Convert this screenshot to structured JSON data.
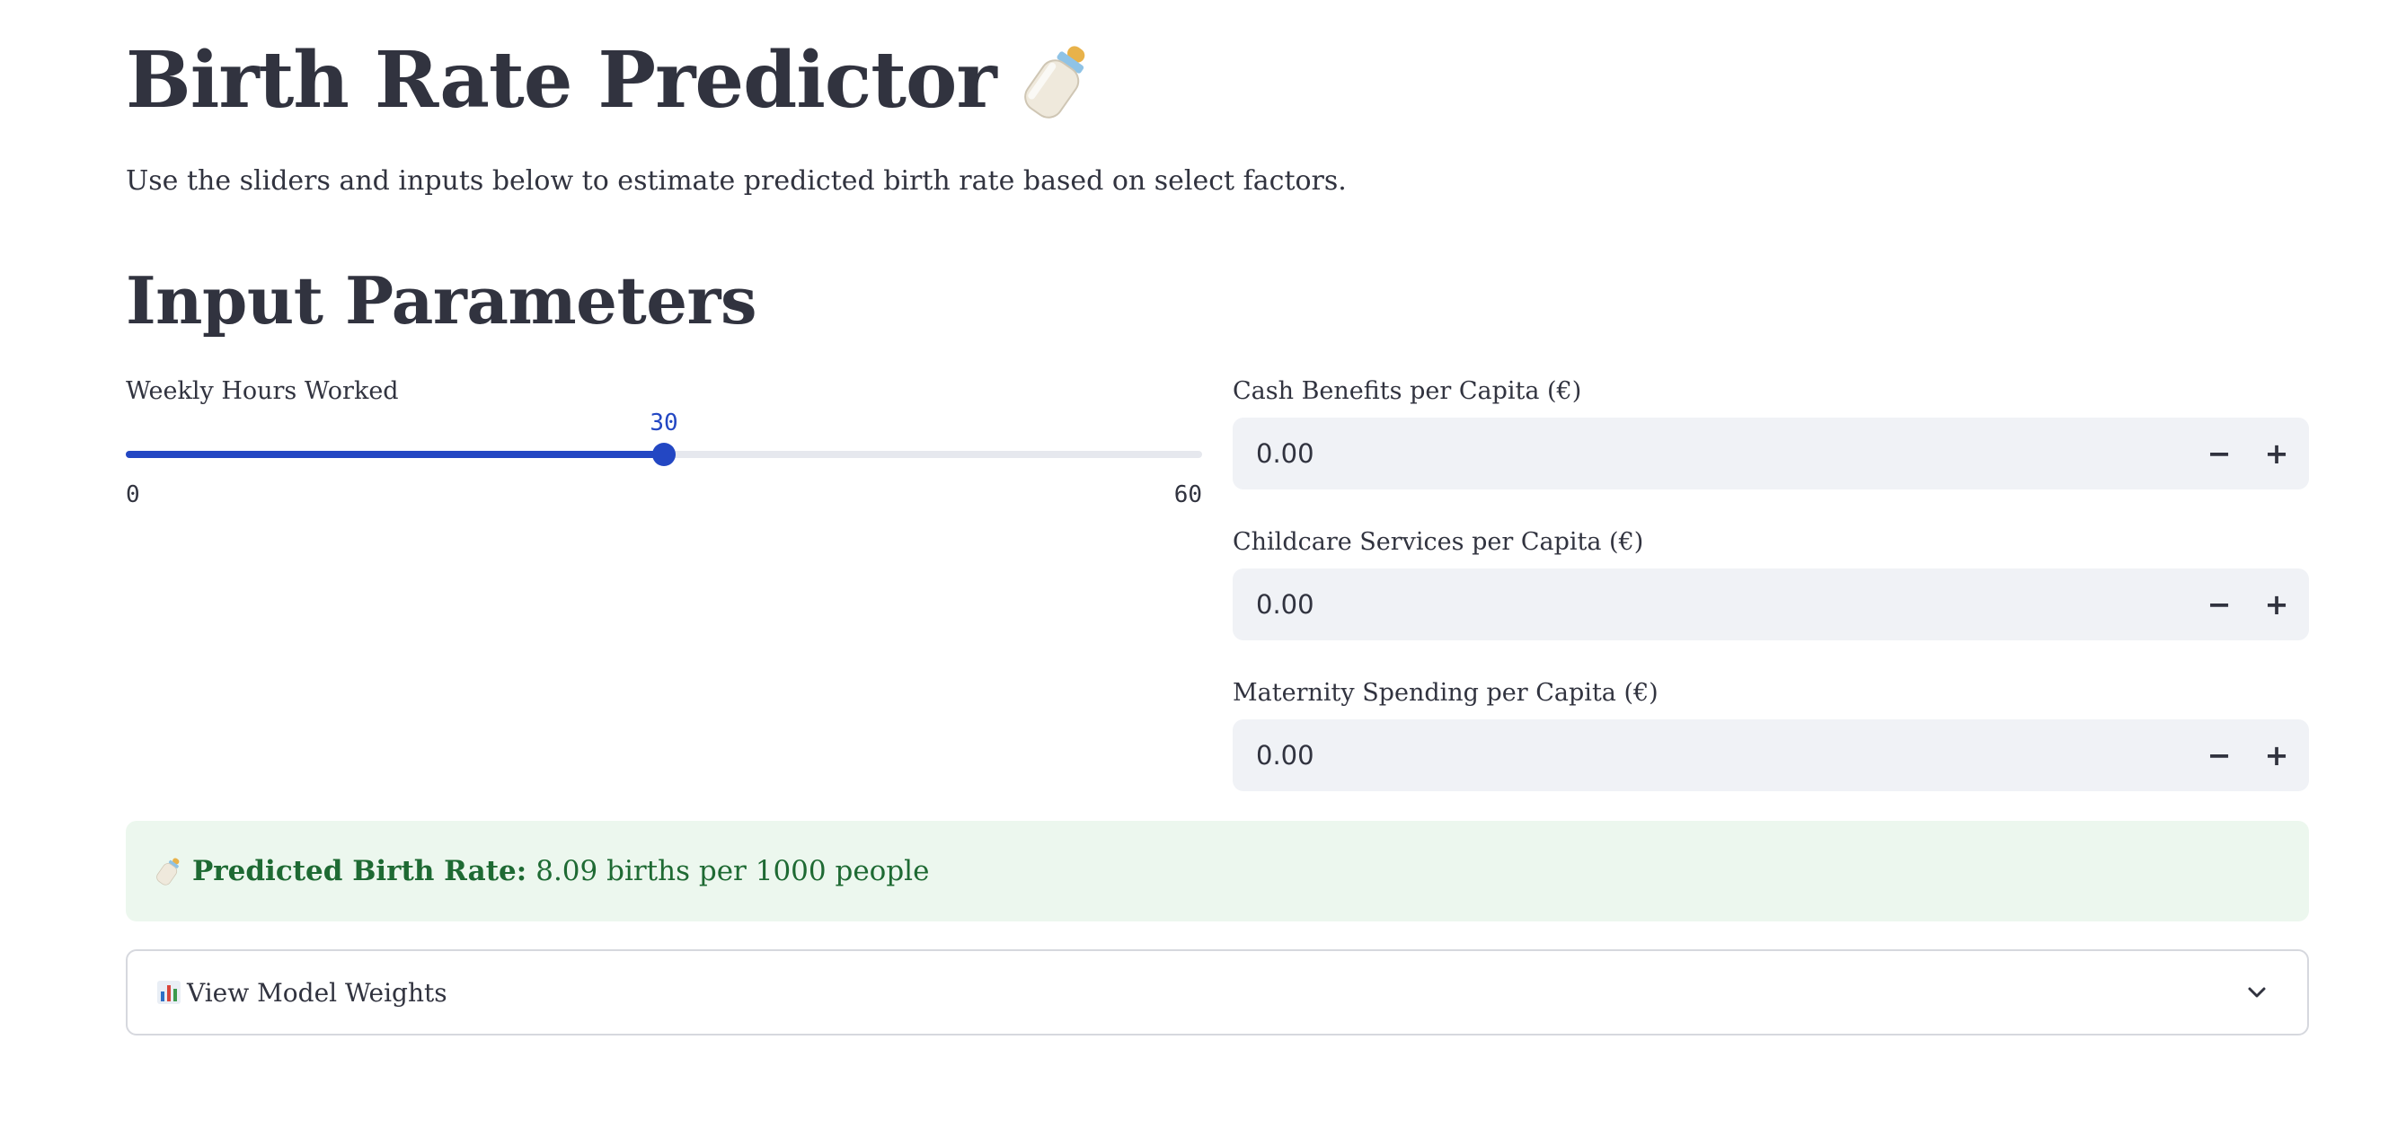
{
  "header": {
    "title": "Birth Rate Predictor",
    "title_icon": "baby-bottle-icon",
    "description": "Use the sliders and inputs below to estimate predicted birth rate based on select factors."
  },
  "inputs": {
    "heading": "Input Parameters",
    "weekly_hours": {
      "label": "Weekly Hours Worked",
      "value": "30",
      "min": "0",
      "max": "60",
      "accent_color": "#2347c3"
    },
    "cash_benefits": {
      "label": "Cash Benefits per Capita (€)",
      "value": "0.00",
      "minus_label": "−",
      "plus_label": "+"
    },
    "childcare_services": {
      "label": "Childcare Services per Capita (€)",
      "value": "0.00",
      "minus_label": "−",
      "plus_label": "+"
    },
    "maternity_spending": {
      "label": "Maternity Spending per Capita (€)",
      "value": "0.00",
      "minus_label": "−",
      "plus_label": "+"
    }
  },
  "result": {
    "icon": "baby-bottle-icon",
    "label": "Predicted Birth Rate:",
    "value_text": "8.09 births per 1000 people",
    "background_color": "#ecf7ee",
    "text_color": "#1e6a33"
  },
  "expander": {
    "icon": "bar-chart-icon",
    "label": "View Model Weights",
    "state_icon": "chevron-down-icon"
  }
}
